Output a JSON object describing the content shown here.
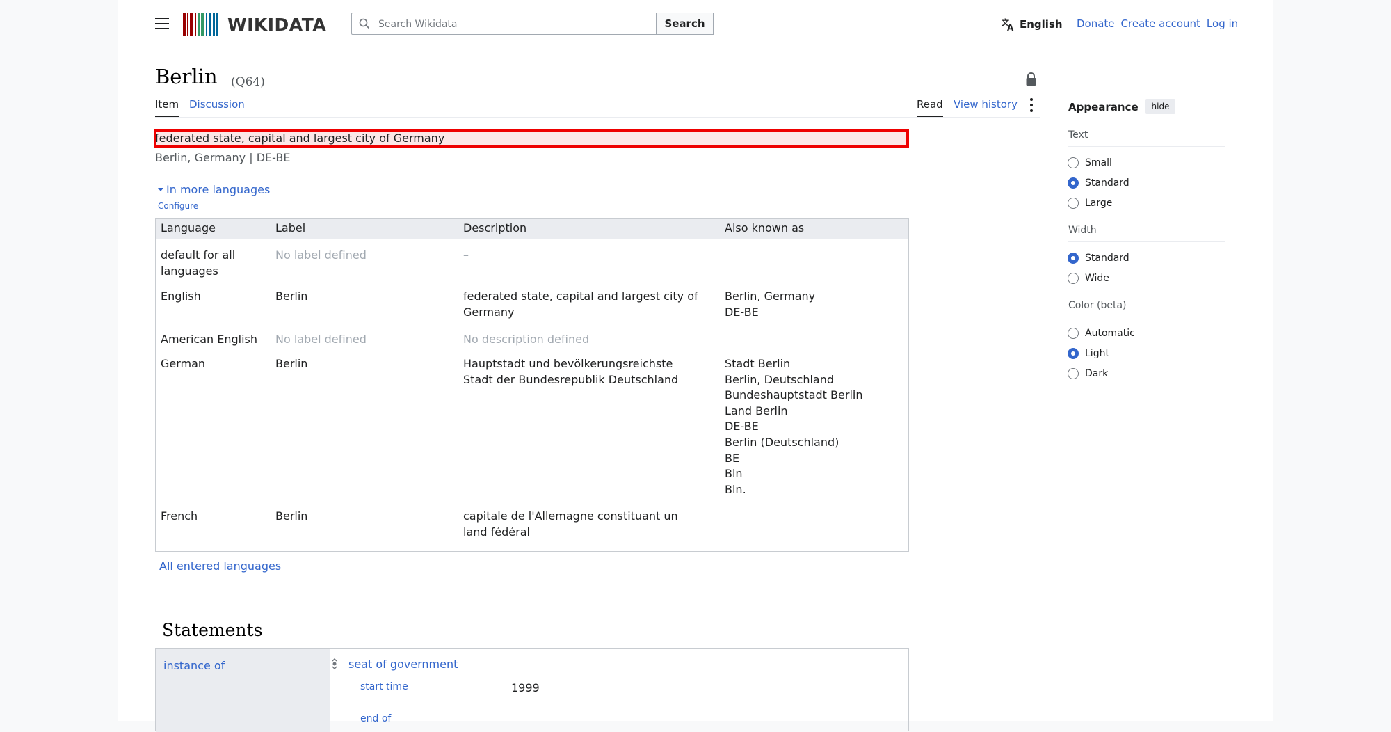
{
  "header": {
    "logo_text": "WIKIDATA",
    "search_placeholder": "Search Wikidata",
    "search_button": "Search",
    "language": "English",
    "links": [
      "Donate",
      "Create account",
      "Log in"
    ]
  },
  "item": {
    "title": "Berlin",
    "qid": "(Q64)",
    "description": "federated state, capital and largest city of Germany",
    "aliases": "Berlin, Germany | DE-BE"
  },
  "tabs": {
    "item": "Item",
    "discussion": "Discussion",
    "read": "Read",
    "view_history": "View history"
  },
  "more_languages": {
    "toggle": "In more languages",
    "configure": "Configure",
    "headers": [
      "Language",
      "Label",
      "Description",
      "Also known as"
    ],
    "rows": [
      {
        "language": "default for all\nlanguages",
        "label": "No label defined",
        "description": "–",
        "aliases": ""
      },
      {
        "language": "English",
        "label": "Berlin",
        "description": "federated state, capital and largest city of\nGermany",
        "aliases": "Berlin, Germany\nDE-BE"
      },
      {
        "language": "American English",
        "label": "No label defined",
        "description": "No description defined",
        "aliases": ""
      },
      {
        "language": "German",
        "label": "Berlin",
        "description": "Hauptstadt und bevölkerungsreichste\nStadt der Bundesrepublik Deutschland",
        "aliases": "Stadt Berlin\nBerlin, Deutschland\nBundeshauptstadt Berlin\nLand Berlin\nDE-BE\nBerlin (Deutschland)\nBE\nBln\nBln."
      },
      {
        "language": "French",
        "label": "Berlin",
        "description": "capitale de l'Allemagne constituant un\nland fédéral",
        "aliases": ""
      }
    ],
    "all_languages": "All entered languages"
  },
  "statements": {
    "heading": "Statements",
    "property": "instance of",
    "value": "seat of government",
    "qualifier_property": "start time",
    "qualifier_value": "1999",
    "qualifier_property_2": "end of"
  },
  "appearance": {
    "title": "Appearance",
    "hide": "hide",
    "sections": [
      {
        "name": "Text",
        "options": [
          "Small",
          "Standard",
          "Large"
        ],
        "selected": "Standard"
      },
      {
        "name": "Width",
        "options": [
          "Standard",
          "Wide"
        ],
        "selected": "Standard"
      },
      {
        "name": "Color (beta)",
        "options": [
          "Automatic",
          "Light",
          "Dark"
        ],
        "selected": "Light"
      }
    ]
  },
  "colors": {
    "link": "#3366cc",
    "highlight_border": "#ee0000",
    "highlight_bg": "#fce7e7",
    "logo_bars": [
      "#990000",
      "#339966",
      "#006699"
    ]
  }
}
